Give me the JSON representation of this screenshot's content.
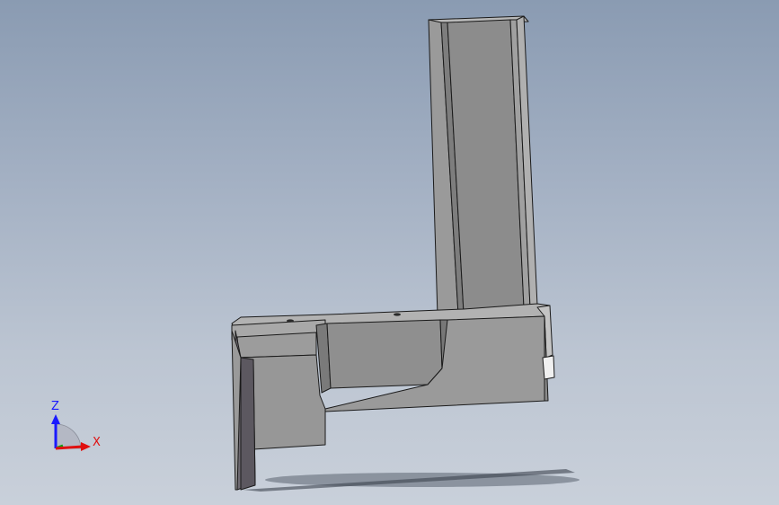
{
  "viewport": {
    "background_top": "#8a9bb2",
    "background_bottom": "#c9d0da"
  },
  "triad": {
    "z_label": "Z",
    "x_label": "X",
    "z_color": "#1a1aff",
    "x_color": "#e01010",
    "y_color": "#10a010"
  },
  "model": {
    "face_color": "#8c8c8c",
    "light_face_color": "#a6a6a6",
    "dark_face_color": "#6a6a6a",
    "edge_color": "#1a1a1a"
  }
}
